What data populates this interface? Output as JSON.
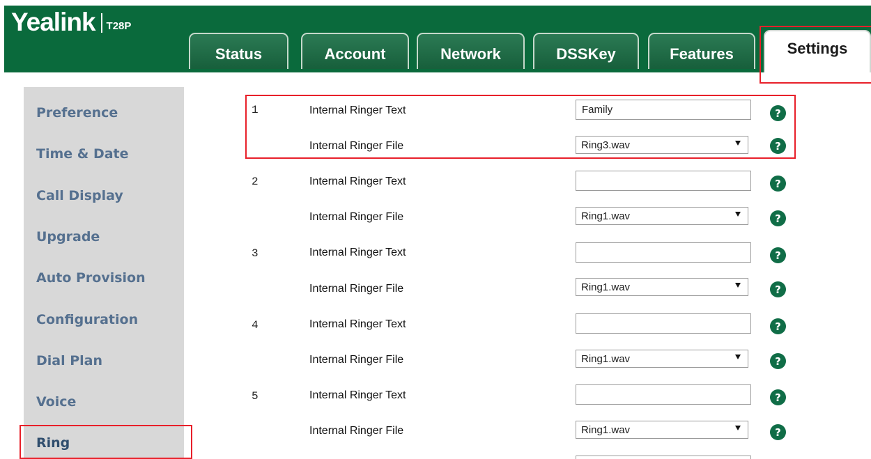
{
  "brand": {
    "name": "Yealink",
    "model": "T28P"
  },
  "tabs": [
    "Status",
    "Account",
    "Network",
    "DSSKey",
    "Features",
    "Settings"
  ],
  "sidebar": {
    "items": [
      "Preference",
      "Time & Date",
      "Call Display",
      "Upgrade",
      "Auto Provision",
      "Configuration",
      "Dial Plan",
      "Voice",
      "Ring"
    ],
    "active": "Ring"
  },
  "rows": [
    {
      "num": "1",
      "text_label": "Internal Ringer Text",
      "text_value": "Family",
      "file_label": "Internal Ringer File",
      "file_value": "Ring3.wav"
    },
    {
      "num": "2",
      "text_label": "Internal Ringer Text",
      "text_value": "",
      "file_label": "Internal Ringer File",
      "file_value": "Ring1.wav"
    },
    {
      "num": "3",
      "text_label": "Internal Ringer Text",
      "text_value": "",
      "file_label": "Internal Ringer File",
      "file_value": "Ring1.wav"
    },
    {
      "num": "4",
      "text_label": "Internal Ringer Text",
      "text_value": "",
      "file_label": "Internal Ringer File",
      "file_value": "Ring1.wav"
    },
    {
      "num": "5",
      "text_label": "Internal Ringer Text",
      "text_value": "",
      "file_label": "Internal Ringer File",
      "file_value": "Ring1.wav"
    }
  ],
  "help_icon": {
    "glyph": "?",
    "color": "#106d47"
  },
  "colors": {
    "header": "#0a6a3c",
    "highlight": "#e8202a",
    "sidebar_bg": "#d8d8d8",
    "sidebar_text": "#55708f"
  }
}
